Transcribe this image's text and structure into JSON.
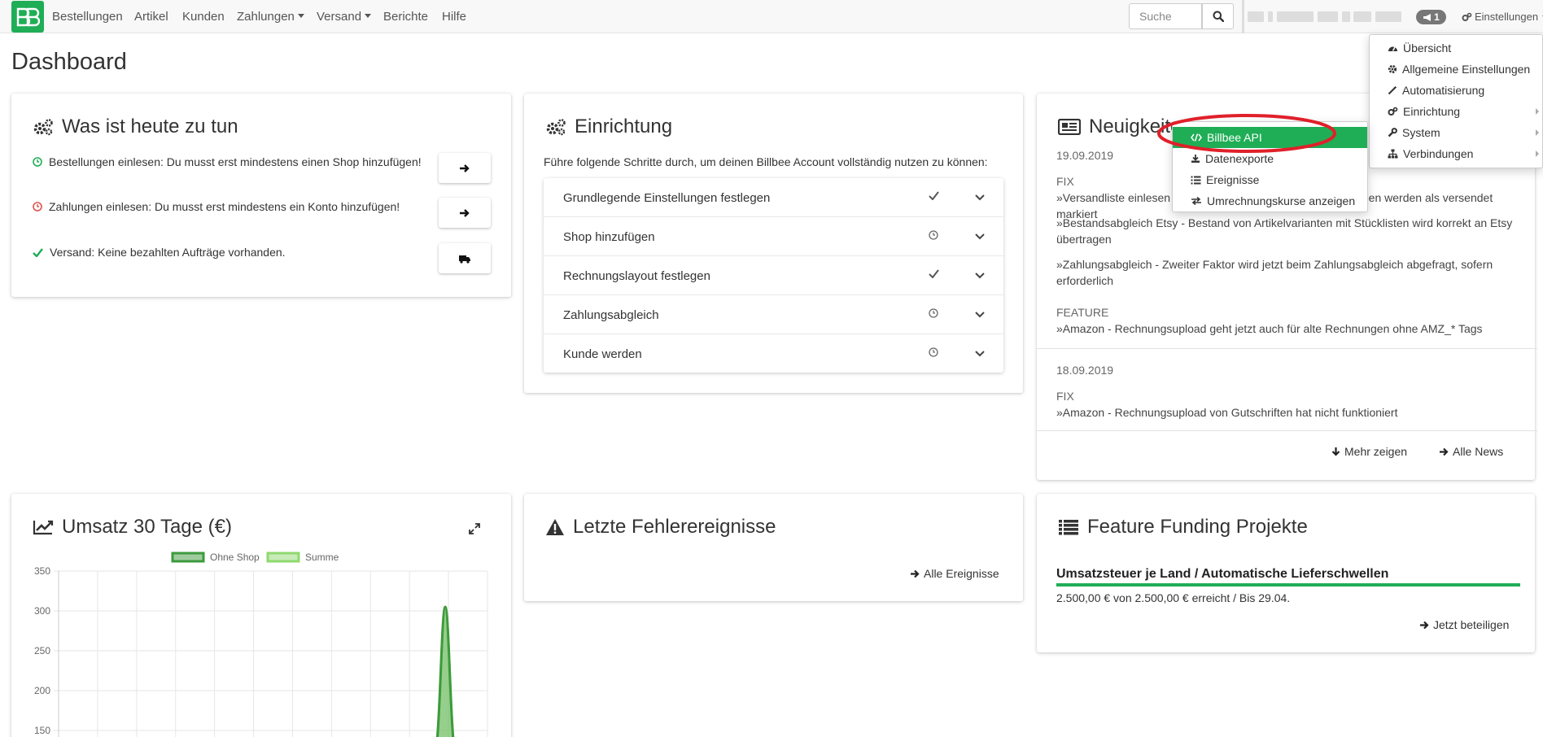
{
  "nav": {
    "items": [
      {
        "label": "Bestellungen"
      },
      {
        "label": "Artikel"
      },
      {
        "label": "Kunden"
      },
      {
        "label": "Zahlungen",
        "dropdown": true
      },
      {
        "label": "Versand",
        "dropdown": true
      },
      {
        "label": "Berichte"
      },
      {
        "label": "Hilfe"
      }
    ],
    "search_placeholder": "Suche",
    "notifications_count": "1",
    "settings_label": "Einstellungen"
  },
  "page_title": "Dashboard",
  "todo": {
    "title": "Was ist heute zu tun",
    "items": [
      {
        "text": "Bestellungen einlesen: Du musst erst mindestens einen Shop hinzufügen!",
        "status": "pending-green"
      },
      {
        "text": "Zahlungen einlesen: Du musst erst mindestens ein Konto hinzufügen!",
        "status": "pending-red"
      },
      {
        "text": "Versand: Keine bezahlten Aufträge vorhanden.",
        "status": "done"
      }
    ]
  },
  "setup": {
    "title": "Einrichtung",
    "intro": "Führe folgende Schritte durch, um deinen Billbee Account vollständig nutzen zu können:",
    "steps": [
      {
        "label": "Grundlegende Einstellungen festlegen",
        "status": "done"
      },
      {
        "label": "Shop hinzufügen",
        "status": "pending"
      },
      {
        "label": "Rechnungslayout festlegen",
        "status": "done"
      },
      {
        "label": "Zahlungsabgleich",
        "status": "pending"
      },
      {
        "label": "Kunde werden",
        "status": "pending"
      }
    ]
  },
  "news": {
    "title": "Neuigkeiten",
    "groups": [
      {
        "date": "19.09.2019",
        "sections": [
          {
            "category": "FIX",
            "entries": [
              "»Versandliste einlesen – Bestellungen mit Versandinformationen werden als versendet markiert",
              "»Bestandsabgleich Etsy - Bestand von Artikelvarianten mit Stücklisten wird korrekt an Etsy übertragen",
              "»Zahlungsabgleich - Zweiter Faktor wird jetzt beim Zahlungsabgleich abgefragt, sofern erforderlich"
            ]
          },
          {
            "category": "FEATURE",
            "entries": [
              "»Amazon - Rechnungsupload geht jetzt auch für alte Rechnungen ohne AMZ_* Tags"
            ]
          }
        ]
      },
      {
        "date": "18.09.2019",
        "sections": [
          {
            "category": "FIX",
            "entries": [
              "»Amazon - Rechnungsupload von Gutschriften hat nicht funktioniert"
            ]
          }
        ]
      }
    ],
    "more_label": "Mehr zeigen",
    "all_label": "Alle News"
  },
  "revenue": {
    "title": "Umsatz 30 Tage (€)"
  },
  "errors": {
    "title": "Letzte Fehlerereignisse",
    "all_label": "Alle Ereignisse"
  },
  "funding": {
    "title": "Feature Funding Projekte",
    "project_title": "Umsatzsteuer je Land / Automatische Lieferschwellen",
    "progress_text": "2.500,00 € von 2.500,00 € erreicht / Bis 29.04.",
    "progress": 1.0,
    "join_label": "Jetzt beteiligen"
  },
  "settings_menu": {
    "items": [
      {
        "label": "Übersicht",
        "icon": "dashboard-icon",
        "submenu": false
      },
      {
        "label": "Allgemeine Einstellungen",
        "icon": "gear-icon",
        "submenu": false
      },
      {
        "label": "Automatisierung",
        "icon": "wand-icon",
        "submenu": false
      },
      {
        "label": "Einrichtung",
        "icon": "gears-icon",
        "submenu": true
      },
      {
        "label": "System",
        "icon": "wrench-icon",
        "submenu": true
      },
      {
        "label": "Verbindungen",
        "icon": "sitemap-icon",
        "submenu": true
      }
    ]
  },
  "system_submenu": {
    "items": [
      {
        "label": "Billbee API",
        "icon": "code-icon",
        "active": true
      },
      {
        "label": "Datenexporte",
        "icon": "download-icon",
        "active": false
      },
      {
        "label": "Ereignisse",
        "icon": "list-icon",
        "active": false
      },
      {
        "label": "Umrechnungskurse anzeigen",
        "icon": "exchange-icon",
        "active": false
      }
    ]
  },
  "colors": {
    "brand": "#1fae56",
    "highlight_ring": "#e0202a"
  },
  "chart_data": {
    "type": "area",
    "title": "",
    "series": [
      {
        "name": "Ohne Shop",
        "color": "#3d9a3d"
      },
      {
        "name": "Summe",
        "color": "#8fd96f"
      }
    ],
    "y_ticks": [
      350,
      300,
      250,
      200,
      150
    ],
    "ylim": [
      150,
      350
    ],
    "peak_value": 305,
    "grid": true,
    "legend": "top-center"
  }
}
